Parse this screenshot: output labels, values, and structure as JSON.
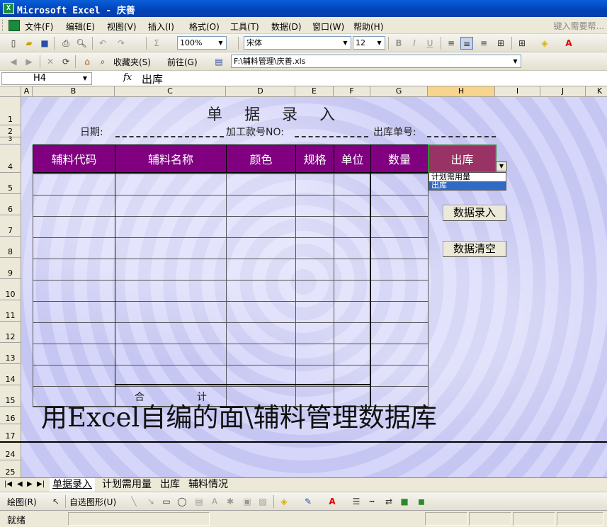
{
  "window": {
    "title": "Microsoft Excel - 庆善",
    "app_icon": "excel-icon"
  },
  "menu": {
    "items": [
      "文件(F)",
      "编辑(E)",
      "视图(V)",
      "插入(I)",
      "格式(O)",
      "工具(T)",
      "数据(D)",
      "窗口(W)",
      "帮助(H)"
    ],
    "help_placeholder": "键入需要帮..."
  },
  "standard_toolbar": {
    "zoom": "100%",
    "font": "宋体",
    "font_size": "12"
  },
  "web_toolbar": {
    "favorites": "收藏夹(S)",
    "goto": "前往(G)",
    "address": "F:\\辅料管理\\庆善.xls"
  },
  "formula_bar": {
    "name_box": "H4",
    "fx": "fx",
    "content": "出库"
  },
  "columns": [
    "A",
    "B",
    "C",
    "D",
    "E",
    "F",
    "G",
    "H",
    "I",
    "J",
    "K"
  ],
  "rows": [
    "1",
    "2",
    "3",
    "4",
    "5",
    "6",
    "7",
    "8",
    "9",
    "10",
    "11",
    "12",
    "13",
    "14",
    "15",
    "16",
    "17",
    "24",
    "25"
  ],
  "form": {
    "title": "单 据 录 入",
    "date_label": "日期:",
    "order_label": "加工款号NO:",
    "out_no_label": "出库单号:",
    "headers": [
      "辅料代码",
      "辅料名称",
      "颜色",
      "规格",
      "单位",
      "数量",
      "出库"
    ],
    "total_left": "合",
    "total_right": "计"
  },
  "dropdown": {
    "options": [
      "计划需用量",
      "出库"
    ],
    "selected": "出库"
  },
  "buttons": {
    "data_entry": "数据录入",
    "data_clear": "数据清空"
  },
  "overlay_caption": "用Excel自编的面\\辅料管理数据库",
  "sheet_tabs": [
    "单据录入",
    "计划需用量",
    "出库",
    "辅料情况"
  ],
  "active_tab": "单据录入",
  "drawing_toolbar": {
    "draw": "绘图(R)",
    "autoshapes": "自选图形(U)"
  },
  "status": {
    "text": "就绪"
  }
}
